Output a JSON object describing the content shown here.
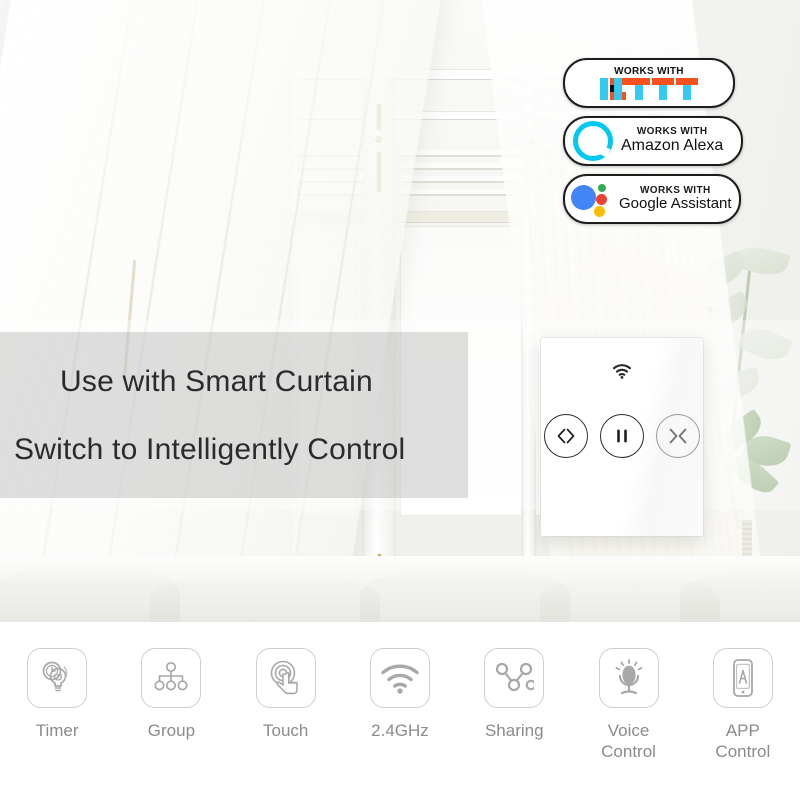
{
  "headline": {
    "line1": "Use with Smart Curtain",
    "line2": "Switch to Intelligently Control"
  },
  "compat_badges": [
    {
      "id": "ifttt",
      "works_with": "WORKS WITH",
      "brand": "IFTTT",
      "logo_icon": "ifttt-logo-icon",
      "colors": {
        "cyan": "#35c8f0",
        "black": "#111111",
        "orange": "#f4511e"
      }
    },
    {
      "id": "alexa",
      "works_with": "WORKS WITH",
      "brand": "Amazon Alexa",
      "logo_icon": "amazon-alexa-ring-icon",
      "colors": {
        "ring": "#00c8f0"
      }
    },
    {
      "id": "google-assistant",
      "works_with": "WORKS WITH",
      "brand": "Google Assistant",
      "logo_icon": "google-assistant-dots-icon",
      "colors": {
        "blue": "#4285f4",
        "green": "#34a853",
        "red": "#ea4335",
        "yellow": "#fbbc05"
      }
    }
  ],
  "switch_panel": {
    "wifi_indicator_icon": "wifi-icon",
    "buttons": [
      {
        "id": "open",
        "icon": "curtain-open-icon",
        "label": "<>"
      },
      {
        "id": "pause",
        "icon": "pause-icon",
        "label": "||"
      },
      {
        "id": "close",
        "icon": "curtain-close-icon",
        "label": "><"
      }
    ]
  },
  "features": [
    {
      "label": "Timer",
      "icon": "timer-bulb-icon"
    },
    {
      "label": "Group",
      "icon": "group-tree-icon"
    },
    {
      "label": "Touch",
      "icon": "touch-hand-icon"
    },
    {
      "label": "2.4GHz",
      "icon": "wifi-signal-icon"
    },
    {
      "label": "Sharing",
      "icon": "sharing-nodes-icon"
    },
    {
      "label": "Voice\nControl",
      "icon": "microphone-icon"
    },
    {
      "label": "APP\nControl",
      "icon": "phone-app-icon"
    }
  ],
  "theme": {
    "headline_color": "#2b2b2b",
    "feature_label_color": "#8b8b8b",
    "feature_icon_stroke": "#a8a8a8",
    "badge_border": "#1d1d1d",
    "overlay_tint": "rgba(150,150,150,0.30)"
  }
}
